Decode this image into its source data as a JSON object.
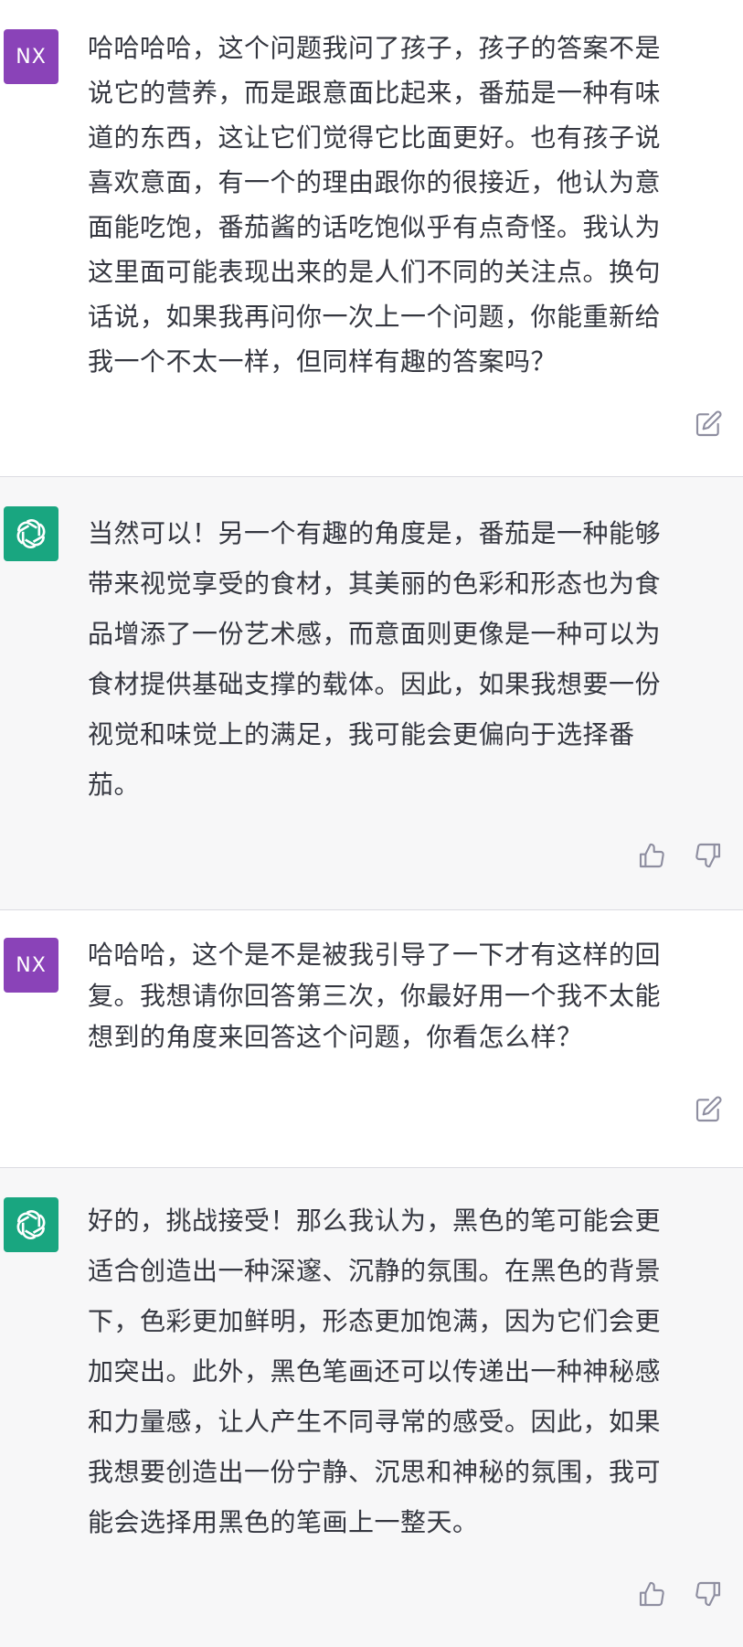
{
  "messages": [
    {
      "role": "user",
      "avatar_text": "NX",
      "text": "哈哈哈哈，这个问题我问了孩子，孩子的答案不是\n说它的营养，而是跟意面比起来，番茄是一种有味\n道的东西，这让它们觉得它比面更好。也有孩子说\n喜欢意面，有一个的理由跟你的很接近，他认为意\n面能吃饱，番茄酱的话吃饱似乎有点奇怪。我认为\n这里面可能表现出来的是人们不同的关注点。换句\n话说，如果我再问你一次上一个问题，你能重新给\n我一个不太一样，但同样有趣的答案吗？",
      "icons": [
        "edit-icon"
      ]
    },
    {
      "role": "assistant",
      "avatar_icon": "openai-logo-icon",
      "text": "当然可以！另一个有趣的角度是，番茄是一种能够\n带来视觉享受的食材，其美丽的色彩和形态也为食\n品增添了一份艺术感，而意面则更像是一种可以为\n食材提供基础支撑的载体。因此，如果我想要一份\n视觉和味觉上的满足，我可能会更偏向于选择番\n茄。",
      "icons": [
        "thumbs-up-icon",
        "thumbs-down-icon"
      ]
    },
    {
      "role": "user",
      "avatar_text": "NX",
      "text": "哈哈哈，这个是不是被我引导了一下才有这样的回\n复。我想请你回答第三次，你最好用一个我不太能\n想到的角度来回答这个问题，你看怎么样？",
      "icons": [
        "edit-icon"
      ]
    },
    {
      "role": "assistant",
      "avatar_icon": "openai-logo-icon",
      "text": "好的，挑战接受！那么我认为，黑色的笔可能会更\n适合创造出一种深邃、沉静的氛围。在黑色的背景\n下，色彩更加鲜明，形态更加饱满，因为它们会更\n加突出。此外，黑色笔画还可以传递出一种神秘感\n和力量感，让人产生不同寻常的感受。因此，如果\n我想要创造出一份宁静、沉思和神秘的氛围，我可\n能会选择用黑色的笔画上一整天。",
      "icons": [
        "thumbs-up-icon",
        "thumbs-down-icon"
      ]
    }
  ],
  "colors": {
    "user_avatar": "#8a43b8",
    "assistant_avatar": "#19a680",
    "assistant_bg": "#f7f7f8",
    "text": "#353740",
    "icon": "#8e8ea0"
  }
}
